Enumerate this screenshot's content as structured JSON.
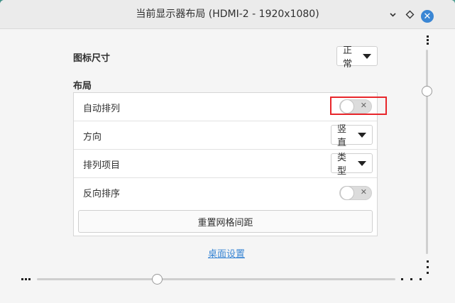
{
  "window": {
    "title": "当前显示器布局 (HDMI-2 - 1920x1080)"
  },
  "titlebar": {
    "minimize_icon": "minimize-icon",
    "maximize_icon": "maximize-icon",
    "close_icon": "close-icon",
    "close_glyph": "✕"
  },
  "icon_size": {
    "label": "图标尺寸",
    "value": "正常"
  },
  "layout": {
    "heading": "布局",
    "auto_arrange": {
      "label": "自动排列",
      "enabled": false
    },
    "direction": {
      "label": "方向",
      "value": "竖直"
    },
    "sort_by": {
      "label": "排列项目",
      "value": "类型"
    },
    "reverse_order": {
      "label": "反向排序",
      "enabled": false
    },
    "reset_button": "重置网格间距"
  },
  "desktop_settings_link": "桌面设置",
  "colors": {
    "accent": "#3a86d4",
    "highlight": "#e8262b"
  }
}
